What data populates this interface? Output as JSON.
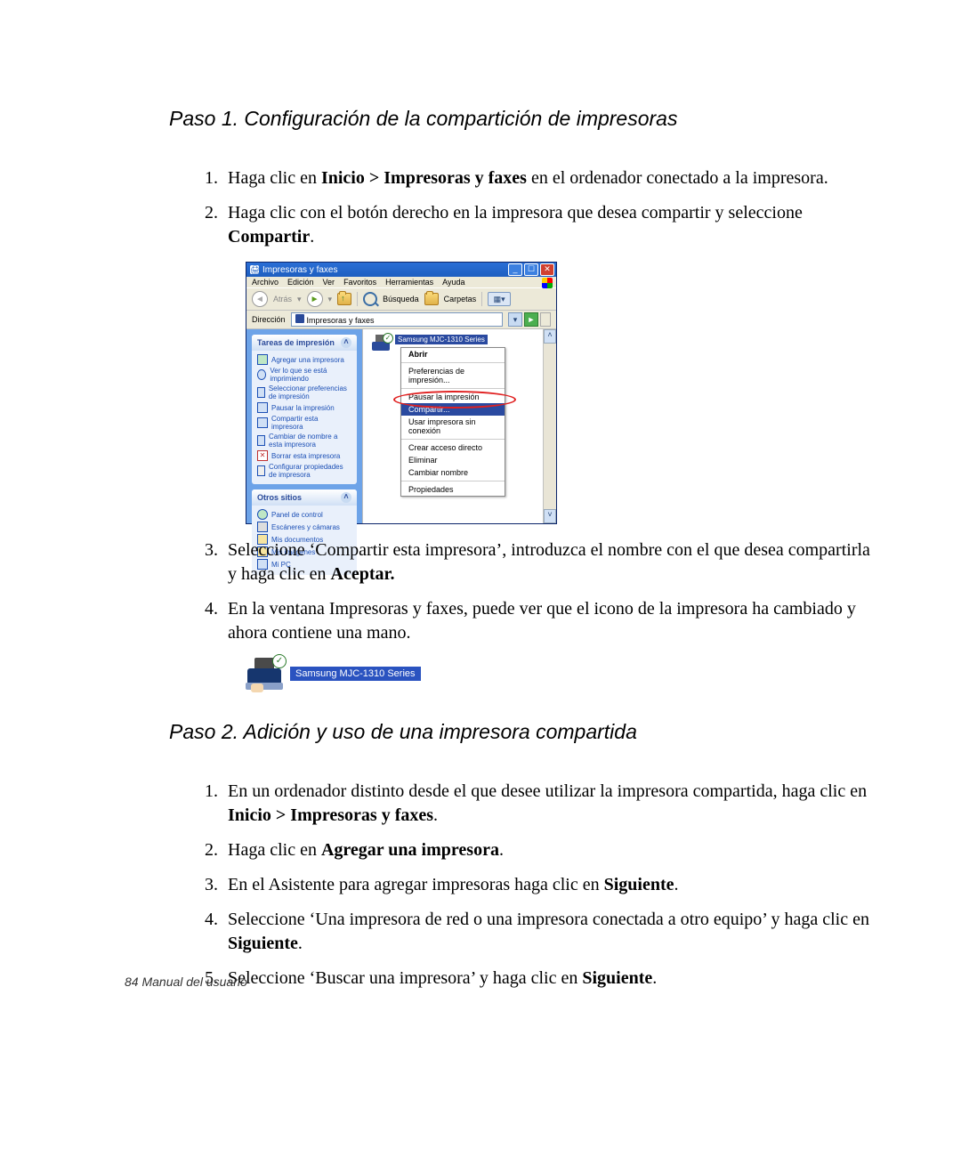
{
  "section1_title": "Paso 1. Configuración de la compartición de impresoras",
  "section2_title": "Paso 2. Adición y uso de una impresora compartida",
  "footer": "84  Manual del usuario",
  "s1": {
    "i1_a": "Haga clic en ",
    "i1_b": "Inicio > Impresoras y faxes",
    "i1_c": " en el ordenador conectado a la impresora.",
    "i2_a": "Haga clic con el botón derecho en la impresora que desea compartir y seleccione ",
    "i2_b": "Compartir",
    "i2_c": ".",
    "i3_a": "Seleccione ‘Compartir esta impresora’, introduzca el nombre con el que desea compartirla y haga clic en ",
    "i3_b": "Aceptar.",
    "i4": "En la ventana Impresoras y faxes, puede ver que el icono de la impresora ha cambiado y ahora contiene una mano."
  },
  "s2": {
    "i1_a": "En un ordenador distinto desde el que desee utilizar la impresora compartida, haga clic en ",
    "i1_b": "Inicio > Impresoras y faxes",
    "i1_c": ".",
    "i2_a": "Haga clic en ",
    "i2_b": "Agregar una impresora",
    "i2_c": ".",
    "i3_a": "En el Asistente para agregar impresoras haga clic en ",
    "i3_b": "Siguiente",
    "i3_c": ".",
    "i4_a": "Seleccione ‘Una impresora de red o una impresora conectada a otro equipo’ y haga clic en ",
    "i4_b": "Siguiente",
    "i4_c": ".",
    "i5_a": "Seleccione ‘Buscar una impresora’ y haga clic en ",
    "i5_b": "Siguiente",
    "i5_c": "."
  },
  "win": {
    "title": "Impresoras y faxes",
    "menu": [
      "Archivo",
      "Edición",
      "Ver",
      "Favoritos",
      "Herramientas",
      "Ayuda"
    ],
    "back": "Atrás",
    "search": "Búsqueda",
    "folders": "Carpetas",
    "addr_label": "Dirección",
    "addr_value": "Impresoras y faxes",
    "side1_head": "Tareas de impresión",
    "side1": [
      "Agregar una impresora",
      "Ver lo que se está imprimiendo",
      "Seleccionar preferencias de impresión",
      "Pausar la impresión",
      "Compartir esta impresora",
      "Cambiar de nombre a esta impresora",
      "Borrar esta impresora",
      "Configurar propiedades de impresora"
    ],
    "side2_head": "Otros sitios",
    "side2": [
      "Panel de control",
      "Escáneres y cámaras",
      "Mis documentos",
      "Mis imágenes",
      "Mi PC"
    ],
    "sel_printer": "Samsung MJC-1310 Series",
    "ctx": {
      "open": "Abrir",
      "pref": "Preferencias de impresión...",
      "pause": "Pausar la impresión",
      "share": "Compartir...",
      "offline": "Usar impresora sin conexión",
      "shortcut": "Crear acceso directo",
      "delete": "Eliminar",
      "rename": "Cambiar nombre",
      "props": "Propiedades"
    }
  },
  "shared_label": "Samsung MJC-1310 Series"
}
